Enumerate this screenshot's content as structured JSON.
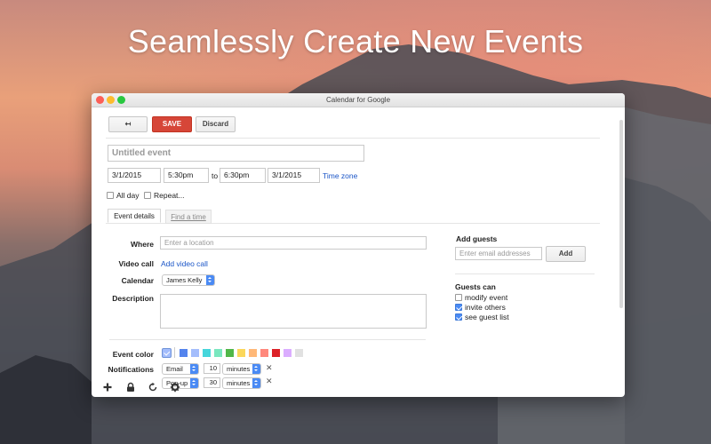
{
  "headline": "Seamlessly Create New Events",
  "window": {
    "title": "Calendar for Google"
  },
  "toolbar": {
    "back_label": "↤",
    "save_label": "SAVE",
    "discard_label": "Discard"
  },
  "event": {
    "title_placeholder": "Untitled event",
    "start_date": "3/1/2015",
    "start_time": "5:30pm",
    "to_label": "to",
    "end_time": "6:30pm",
    "end_date": "3/1/2015",
    "timezone_label": "Time zone",
    "all_day_label": "All day",
    "repeat_label": "Repeat..."
  },
  "tabs": [
    {
      "label": "Event details",
      "active": true
    },
    {
      "label": "Find a time",
      "active": false
    }
  ],
  "details": {
    "where_label": "Where",
    "where_placeholder": "Enter a location",
    "video_label": "Video call",
    "video_link": "Add video call",
    "calendar_label": "Calendar",
    "calendar_value": "James Kelly",
    "description_label": "Description",
    "event_color_label": "Event color",
    "notifications_label": "Notifications"
  },
  "notifications": [
    {
      "method": "Email",
      "amount": "10",
      "unit": "minutes"
    },
    {
      "method": "Pop-up",
      "amount": "30",
      "unit": "minutes"
    }
  ],
  "colors": {
    "selected": "#a4bdfc",
    "swatches": [
      "#5484ed",
      "#a4bdfc",
      "#46d6db",
      "#7ae7bf",
      "#51b749",
      "#fbd75b",
      "#ffb878",
      "#ff887c",
      "#dc2127",
      "#dbadff",
      "#e1e1e1"
    ]
  },
  "guests": {
    "add_label": "Add guests",
    "input_placeholder": "Enter email addresses",
    "add_button": "Add",
    "can_label": "Guests can",
    "permissions": [
      {
        "label": "modify event",
        "checked": false
      },
      {
        "label": "invite others",
        "checked": true
      },
      {
        "label": "see guest list",
        "checked": true
      }
    ]
  },
  "bottom_icons": [
    "plus-icon",
    "lock-icon",
    "refresh-icon",
    "gear-icon"
  ],
  "accent": "#d64638"
}
